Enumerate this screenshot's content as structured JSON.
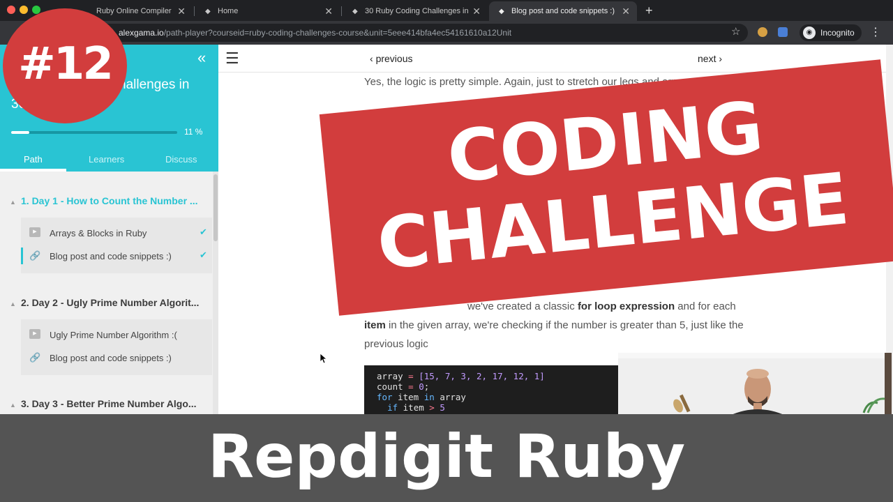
{
  "browser": {
    "tabs": [
      {
        "title": "Ruby Online Compiler",
        "active": false
      },
      {
        "title": "Home",
        "active": false
      },
      {
        "title": "30 Ruby Coding Challenges in",
        "active": false
      },
      {
        "title": "Blog post and code snippets :)",
        "active": true
      }
    ],
    "url_domain": "alexgama.io",
    "url_path": "/path-player?courseid=ruby-coding-challenges-course&unit=5eee414bfa4ec54161610a12Unit",
    "incognito_label": "Incognito",
    "icons": {
      "star": "star-icon",
      "close": "close-icon",
      "new_tab": "plus-icon",
      "menu": "kebab-menu-icon"
    }
  },
  "sidebar": {
    "course_title_visible": "hallenges in",
    "course_title_line2": "30",
    "progress": 11,
    "progress_text": "11 %",
    "tabs": [
      "Path",
      "Learners",
      "Discuss"
    ],
    "active_tab": "Path",
    "sections": [
      {
        "title": "1. Day 1 - How to Count the Number ...",
        "current": true,
        "units": [
          {
            "type": "video",
            "label": "Arrays & Blocks in Ruby",
            "done": true
          },
          {
            "type": "link",
            "label": "Blog post and code snippets :)",
            "done": true,
            "selected": true
          }
        ]
      },
      {
        "title": "2. Day 2 - Ugly Prime Number Algorit...",
        "current": false,
        "units": [
          {
            "type": "video",
            "label": "Ugly Prime Number Algorithm :(",
            "done": false
          },
          {
            "type": "link",
            "label": "Blog post and code snippets :)",
            "done": false
          }
        ]
      },
      {
        "title": "3. Day 3 - Better Prime Number Algo...",
        "current": false,
        "units": []
      }
    ]
  },
  "content": {
    "prev_label": "previous",
    "next_label": "next",
    "para1": "Yes, the logic is pretty simple. Again, just to stretch our legs and arms to the run",
    "para2_visible": "we've created a classic ",
    "para2_bold1": "for loop expression",
    "para2_mid": " and for each ",
    "para2_bold2": "item",
    "para2_end": " in the given array, we're checking if the number is greater than 5, just like the previous logic",
    "code": {
      "line1_var": "array",
      "line1_eq": " = ",
      "line1_values": "[15, 7, 3, 2, 17, 12, 1]",
      "line2_var": "count",
      "line2_eq": " = ",
      "line2_value": "0",
      "line2_end": ";",
      "line3_kw": "for",
      "line3_mid": " item ",
      "line3_kw2": "in",
      "line3_end": " array",
      "line4_kw": "if",
      "line4_mid": " item ",
      "line4_op": ">",
      "line4_value": " 5"
    }
  },
  "overlay": {
    "badge": "#12",
    "banner_line1": "CODING",
    "banner_line2": "CHALLENGE",
    "bottom_title": "Repdigit Ruby"
  },
  "colors": {
    "accent": "#29c4d3",
    "overlay_red": "#d23d3d",
    "bottom_bar": "#545454"
  }
}
